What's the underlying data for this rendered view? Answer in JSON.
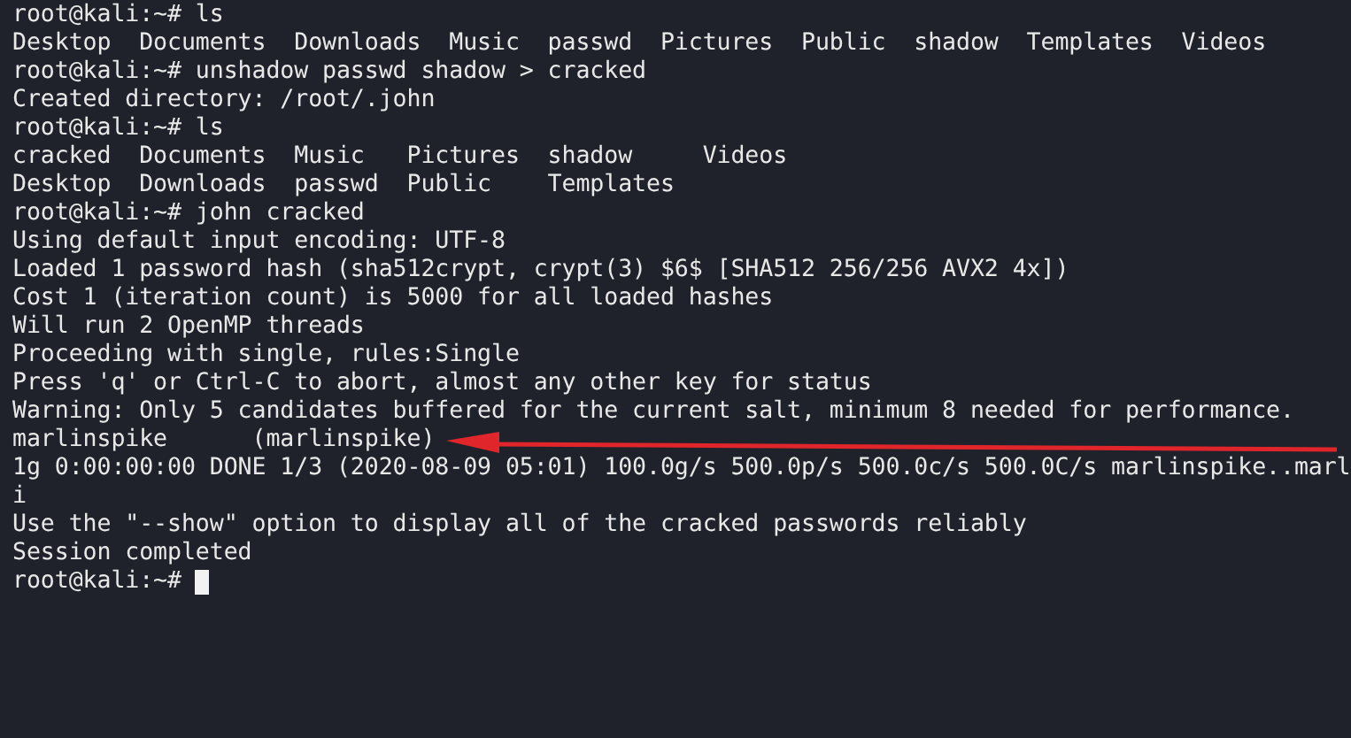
{
  "terminal": {
    "lines": [
      "root@kali:~# ls",
      "Desktop  Documents  Downloads  Music  passwd  Pictures  Public  shadow  Templates  Videos",
      "root@kali:~# unshadow passwd shadow > cracked",
      "Created directory: /root/.john",
      "root@kali:~# ls",
      "cracked  Documents  Music   Pictures  shadow     Videos",
      "Desktop  Downloads  passwd  Public    Templates",
      "root@kali:~# john cracked",
      "Using default input encoding: UTF-8",
      "Loaded 1 password hash (sha512crypt, crypt(3) $6$ [SHA512 256/256 AVX2 4x])",
      "Cost 1 (iteration count) is 5000 for all loaded hashes",
      "Will run 2 OpenMP threads",
      "Proceeding with single, rules:Single",
      "Press 'q' or Ctrl-C to abort, almost any other key for status",
      "Warning: Only 5 candidates buffered for the current salt, minimum 8 needed for performance.",
      "marlinspike      (marlinspike)",
      "1g 0:00:00:00 DONE 1/3 (2020-08-09 05:01) 100.0g/s 500.0p/s 500.0c/s 500.0C/s marlinspike..marl",
      "i",
      "Use the \"--show\" option to display all of the cracked passwords reliably",
      "Session completed",
      "root@kali:~# "
    ],
    "cursor_visible": true
  }
}
